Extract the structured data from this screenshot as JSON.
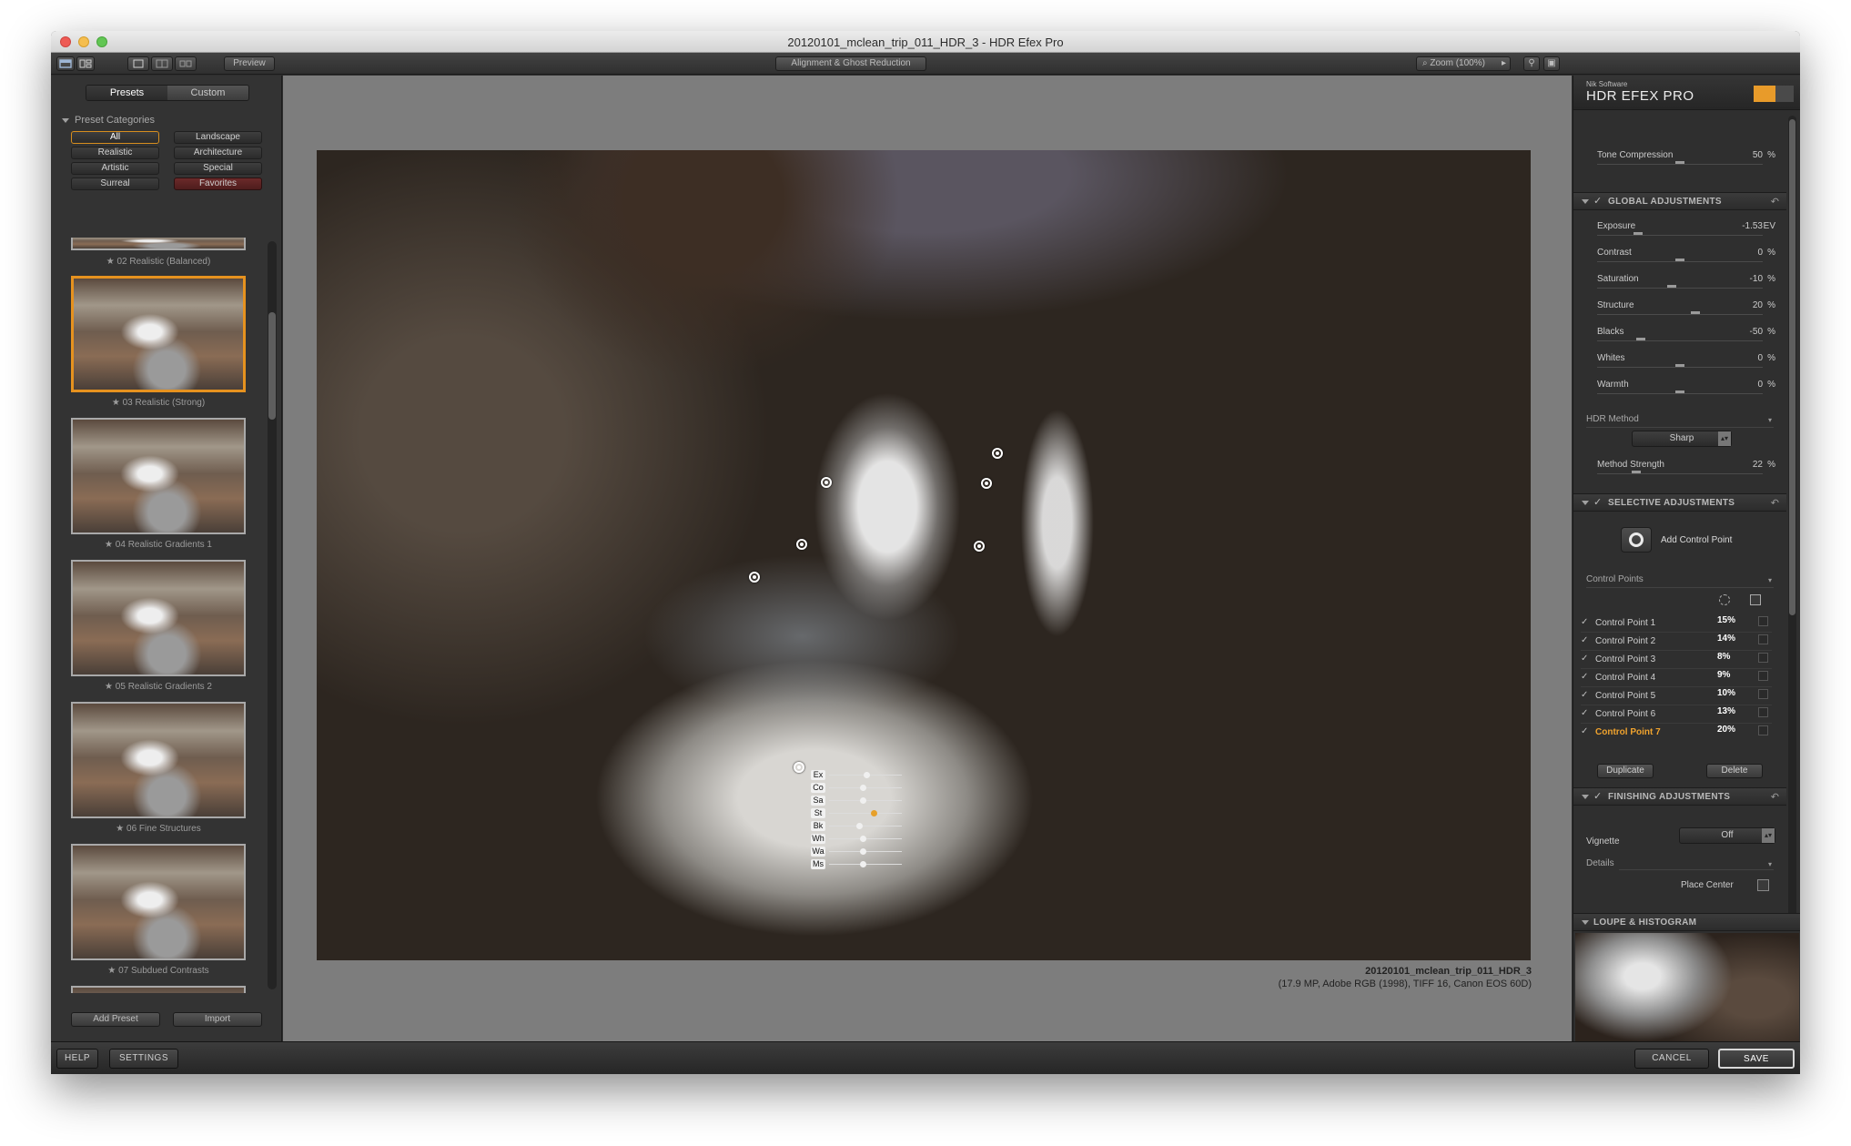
{
  "window": {
    "title": "20120101_mclean_trip_011_HDR_3 - HDR Efex Pro"
  },
  "toolbar": {
    "preview_label": "Preview",
    "center_label": "Alignment & Ghost Reduction",
    "zoom_label": "Zoom (100%)"
  },
  "left_panel": {
    "tabs": [
      "Presets",
      "Custom"
    ],
    "active_tab": "Presets",
    "section_title": "Preset Categories",
    "categories": [
      "All",
      "Landscape",
      "Realistic",
      "Architecture",
      "Artistic",
      "Special",
      "Surreal",
      "Favorites"
    ],
    "active_category": "All",
    "presets": [
      "★ 02 Realistic (Balanced)",
      "★ 03 Realistic (Strong)",
      "★ 04 Realistic Gradients 1",
      "★ 05 Realistic Gradients 2",
      "★ 06 Fine Structures",
      "★ 07 Subdued Contrasts",
      ""
    ],
    "selected_preset": "★ 03 Realistic (Strong)",
    "add_preset_label": "Add Preset",
    "import_label": "Import"
  },
  "image": {
    "filename": "20120101_mclean_trip_011_HDR_3",
    "details": "(17.9 MP, Adobe RGB (1998), TIFF 16, Canon EOS 60D)",
    "control_point_tags": [
      "Ex",
      "Co",
      "Sa",
      "St",
      "Bk",
      "Wh",
      "Wa",
      "Ms"
    ],
    "control_point_levels": [
      0.5,
      0.45,
      0.45,
      0.6,
      0.4,
      0.45,
      0.45,
      0.45
    ]
  },
  "right_panel": {
    "brand_small": "Nik Software",
    "brand_title": "HDR EFEX PRO",
    "tone_compression": {
      "label": "Tone Compression",
      "value": "50",
      "unit": "%",
      "level": 0.5
    },
    "global": {
      "title": "GLOBAL ADJUSTMENTS",
      "sliders": [
        {
          "label": "Exposure",
          "value": "-1.53",
          "unit": "EV",
          "level": 0.23
        },
        {
          "label": "Contrast",
          "value": "0",
          "unit": "%",
          "level": 0.5
        },
        {
          "label": "Saturation",
          "value": "-10",
          "unit": "%",
          "level": 0.45
        },
        {
          "label": "Structure",
          "value": "20",
          "unit": "%",
          "level": 0.6
        },
        {
          "label": "Blacks",
          "value": "-50",
          "unit": "%",
          "level": 0.25
        },
        {
          "label": "Whites",
          "value": "0",
          "unit": "%",
          "level": 0.5
        },
        {
          "label": "Warmth",
          "value": "0",
          "unit": "%",
          "level": 0.5
        }
      ],
      "hdr_method_label": "HDR Method",
      "hdr_method_value": "Sharp",
      "method_strength": {
        "label": "Method Strength",
        "value": "22",
        "unit": "%",
        "level": 0.22
      }
    },
    "selective": {
      "title": "SELECTIVE ADJUSTMENTS",
      "add_label": "Add Control Point",
      "list_label": "Control Points",
      "points": [
        {
          "name": "Control Point 1",
          "pct": "15%"
        },
        {
          "name": "Control Point 2",
          "pct": "14%"
        },
        {
          "name": "Control Point 3",
          "pct": "8%"
        },
        {
          "name": "Control Point 4",
          "pct": "9%"
        },
        {
          "name": "Control Point 5",
          "pct": "10%"
        },
        {
          "name": "Control Point 6",
          "pct": "13%"
        },
        {
          "name": "Control Point 7",
          "pct": "20%"
        }
      ],
      "selected_point": "Control Point 7",
      "duplicate_label": "Duplicate",
      "delete_label": "Delete"
    },
    "finishing": {
      "title": "FINISHING ADJUSTMENTS",
      "vignette_label": "Vignette",
      "vignette_value": "Off",
      "details_label": "Details",
      "place_center_label": "Place Center"
    },
    "loupe_title": "LOUPE & HISTOGRAM"
  },
  "bottom": {
    "help_label": "HELP",
    "settings_label": "SETTINGS",
    "cancel_label": "CANCEL",
    "save_label": "SAVE"
  },
  "colors": {
    "accent": "#e6921f",
    "panel": "#2f2f2f",
    "canvas": "#7d7d7d"
  }
}
